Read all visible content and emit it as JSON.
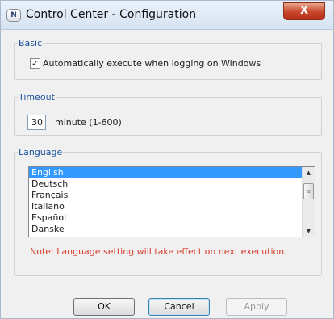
{
  "window": {
    "title": "Control Center - Configuration",
    "app_icon_text": "N",
    "close_label": "X"
  },
  "basic": {
    "legend": "Basic",
    "auto_execute_checked": true,
    "auto_execute_label": "Automatically execute when logging on Windows"
  },
  "timeout": {
    "legend": "Timeout",
    "value": "30",
    "unit_label": "minute (1-600)"
  },
  "language": {
    "legend": "Language",
    "items": [
      "English",
      "Deutsch",
      "Français",
      "Italiano",
      "Español",
      "Danske"
    ],
    "selected": "English",
    "note": "Note: Language setting will take effect on next execution."
  },
  "buttons": {
    "ok": "OK",
    "cancel": "Cancel",
    "apply": "Apply"
  }
}
